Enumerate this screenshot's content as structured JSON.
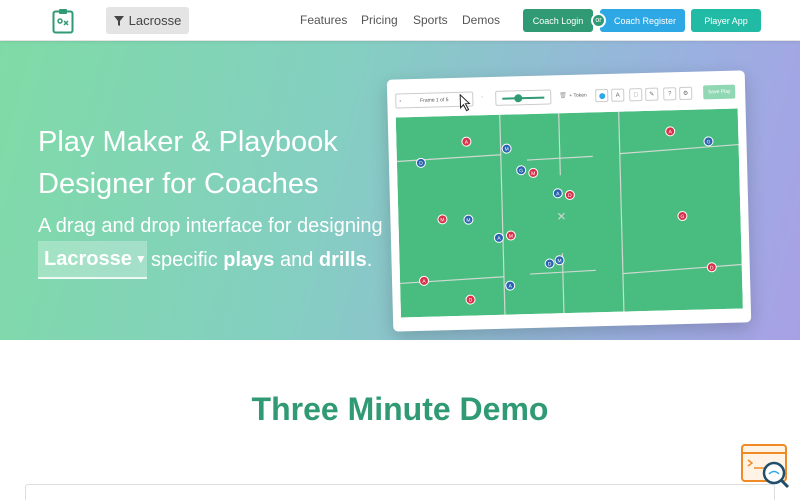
{
  "nav": {
    "brand_icon": "clipboard-playbook-icon",
    "sport_filter_label": "Lacrosse",
    "links": [
      "Features",
      "Pricing",
      "Sports",
      "Demos"
    ],
    "coach_login": "Coach Login",
    "or_label": "or",
    "coach_register": "Coach Register",
    "player_app": "Player App"
  },
  "hero": {
    "title": "Play Maker & Playbook Designer for Coaches",
    "subtitle": "A drag and drop interface for designing",
    "sport_select": "Lacrosse",
    "line2_pre": "specific",
    "line2_plays": "plays",
    "line2_and": "and",
    "line2_drills": "drills",
    "line2_end": "."
  },
  "app_preview": {
    "frame_label": "Frame 1 of 5",
    "token_label": "+ Token",
    "save_play": "Save Play",
    "field_color": "#48bd7f",
    "line_color": "#cfd8d1",
    "player_colors": {
      "offense": "#2a63b0",
      "defense": "#d8324a",
      "goalie": "#2a63b0"
    },
    "players": [
      {
        "label": "A",
        "team": "defense"
      },
      {
        "label": "D",
        "team": "offense"
      },
      {
        "label": "M",
        "team": "offense"
      },
      {
        "label": "G",
        "team": "offense"
      },
      {
        "label": "M",
        "team": "defense"
      },
      {
        "label": "A",
        "team": "offense"
      },
      {
        "label": "D",
        "team": "defense"
      },
      {
        "label": "A",
        "team": "defense"
      },
      {
        "label": "G",
        "team": "offense"
      },
      {
        "label": "M",
        "team": "offense"
      },
      {
        "label": "M",
        "team": "defense"
      },
      {
        "label": "A",
        "team": "offense"
      },
      {
        "label": "M",
        "team": "defense"
      },
      {
        "label": "D",
        "team": "offense"
      },
      {
        "label": "M",
        "team": "offense"
      },
      {
        "label": "A",
        "team": "defense"
      },
      {
        "label": "A",
        "team": "offense"
      },
      {
        "label": "D",
        "team": "defense"
      },
      {
        "label": "G",
        "team": "defense"
      },
      {
        "label": "D",
        "team": "defense"
      }
    ]
  },
  "section": {
    "title": "Three Minute Demo"
  },
  "widget": {
    "icon": "code-search-icon"
  },
  "colors": {
    "brand_green": "#2f9a73",
    "register_blue": "#2da8e5",
    "player_teal": "#21bba5"
  }
}
